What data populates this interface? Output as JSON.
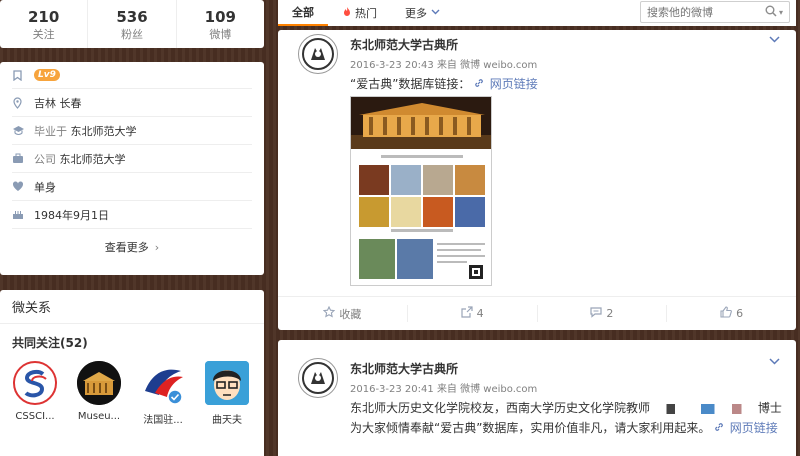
{
  "stats": [
    {
      "num": "210",
      "label": "关注"
    },
    {
      "num": "536",
      "label": "粉丝"
    },
    {
      "num": "109",
      "label": "微博"
    }
  ],
  "info": {
    "level": "Lv9",
    "location": "吉林 长春",
    "edu_prefix": "毕业于",
    "edu": "东北师范大学",
    "company_prefix": "公司",
    "company": "东北师范大学",
    "relationship": "单身",
    "birthday": "1984年9月1日",
    "see_more": "查看更多"
  },
  "relations": {
    "title": "微关系",
    "common_label": "共同关注",
    "common_count": "(52)",
    "avatars": [
      {
        "name": "CSSCI..."
      },
      {
        "name": "Museu..."
      },
      {
        "name": "法国驻..."
      },
      {
        "name": "曲天夫"
      }
    ]
  },
  "tabs": {
    "all": "全部",
    "hot": "热门",
    "more": "更多",
    "search_placeholder": "搜索他的微博"
  },
  "posts": [
    {
      "author": "东北师范大学古典所",
      "time": "2016-3-23 20:43",
      "via": "来自 微博 weibo.com",
      "text": "“爱古典”数据库链接：",
      "link": "网页链接",
      "actions": {
        "fav": "收藏",
        "share": "4",
        "comment": "2",
        "like": "6"
      }
    },
    {
      "author": "东北师范大学古典所",
      "time": "2016-3-23 20:41",
      "via": "来自 微博 weibo.com",
      "text": "东北师大历史文化学院校友，西南大学历史文化学院教师",
      "text_tail": "博士为大家倾情奉献“爱古典”数据库，实用价值非凡，请大家利用起来。",
      "link": "网页链接"
    }
  ],
  "colors": {
    "accent": "#ff8200",
    "link": "#5d7ab8",
    "background": "#4a2f22"
  }
}
